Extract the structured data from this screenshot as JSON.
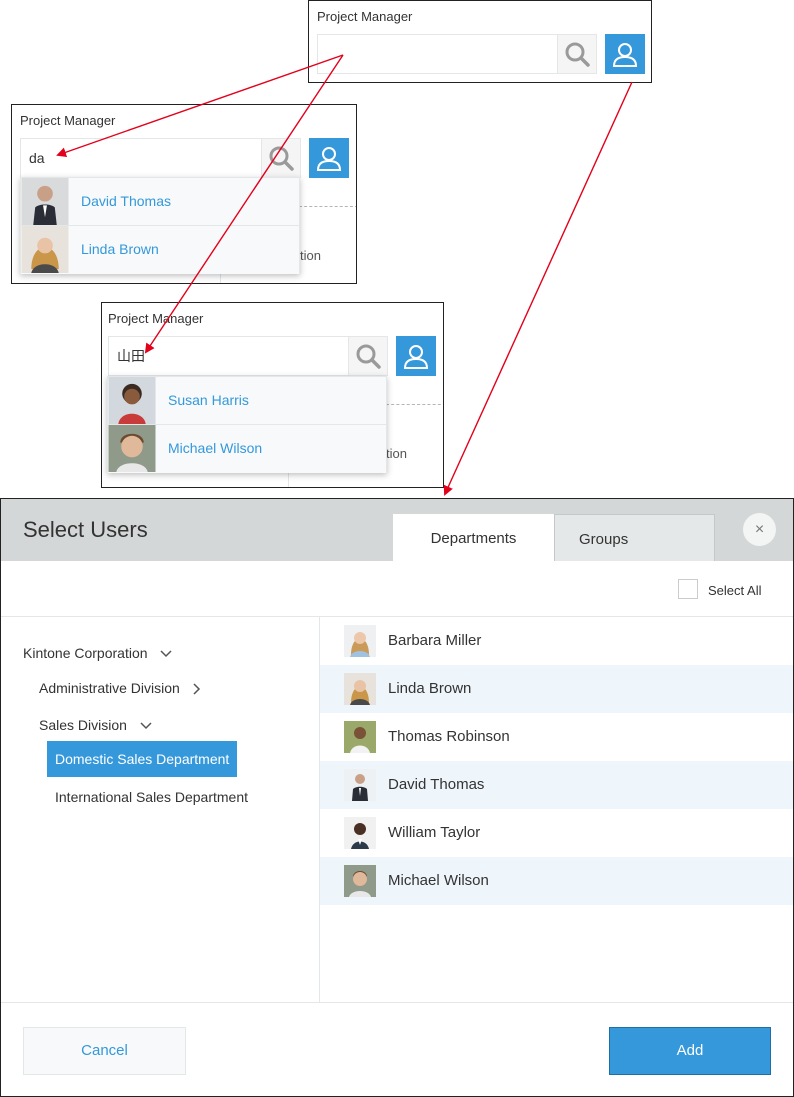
{
  "field_label": "Project Manager",
  "panel1": {
    "input_value": ""
  },
  "panel2": {
    "input_value": "da",
    "background_text": "tion",
    "suggestions": [
      {
        "name": "David Thomas"
      },
      {
        "name": "Linda Brown"
      }
    ]
  },
  "panel3": {
    "input_value": "山田",
    "background_text": "tion",
    "suggestions": [
      {
        "name": "Susan Harris"
      },
      {
        "name": "Michael Wilson"
      }
    ]
  },
  "dialog": {
    "title": "Select Users",
    "tabs": [
      {
        "label": "Departments",
        "active": true
      },
      {
        "label": "Groups",
        "active": false
      }
    ],
    "close_glyph": "×",
    "select_all_label": "Select All",
    "tree": [
      {
        "label": "Kintone Corporation",
        "level": 0,
        "chevron": "down"
      },
      {
        "label": "Administrative Division",
        "level": 1,
        "chevron": "right"
      },
      {
        "label": "Sales Division",
        "level": 1,
        "chevron": "down"
      },
      {
        "label": "Domestic Sales Department",
        "level": 2,
        "selected": true
      },
      {
        "label": "International Sales Department",
        "level": 2
      }
    ],
    "users": [
      {
        "name": "Barbara Miller"
      },
      {
        "name": "Linda Brown"
      },
      {
        "name": "Thomas Robinson"
      },
      {
        "name": "David Thomas"
      },
      {
        "name": "William Taylor"
      },
      {
        "name": "Michael Wilson"
      }
    ],
    "cancel_label": "Cancel",
    "add_label": "Add"
  },
  "colors": {
    "accent": "#3498db",
    "arrow": "#e3001b",
    "header_bg": "#d4d7d7",
    "row_highlight": "#eef6fc"
  },
  "icons": {
    "search": "magnifier-icon",
    "user": "user-outline-icon",
    "close": "close-icon",
    "chevron": "chevron-icon"
  }
}
